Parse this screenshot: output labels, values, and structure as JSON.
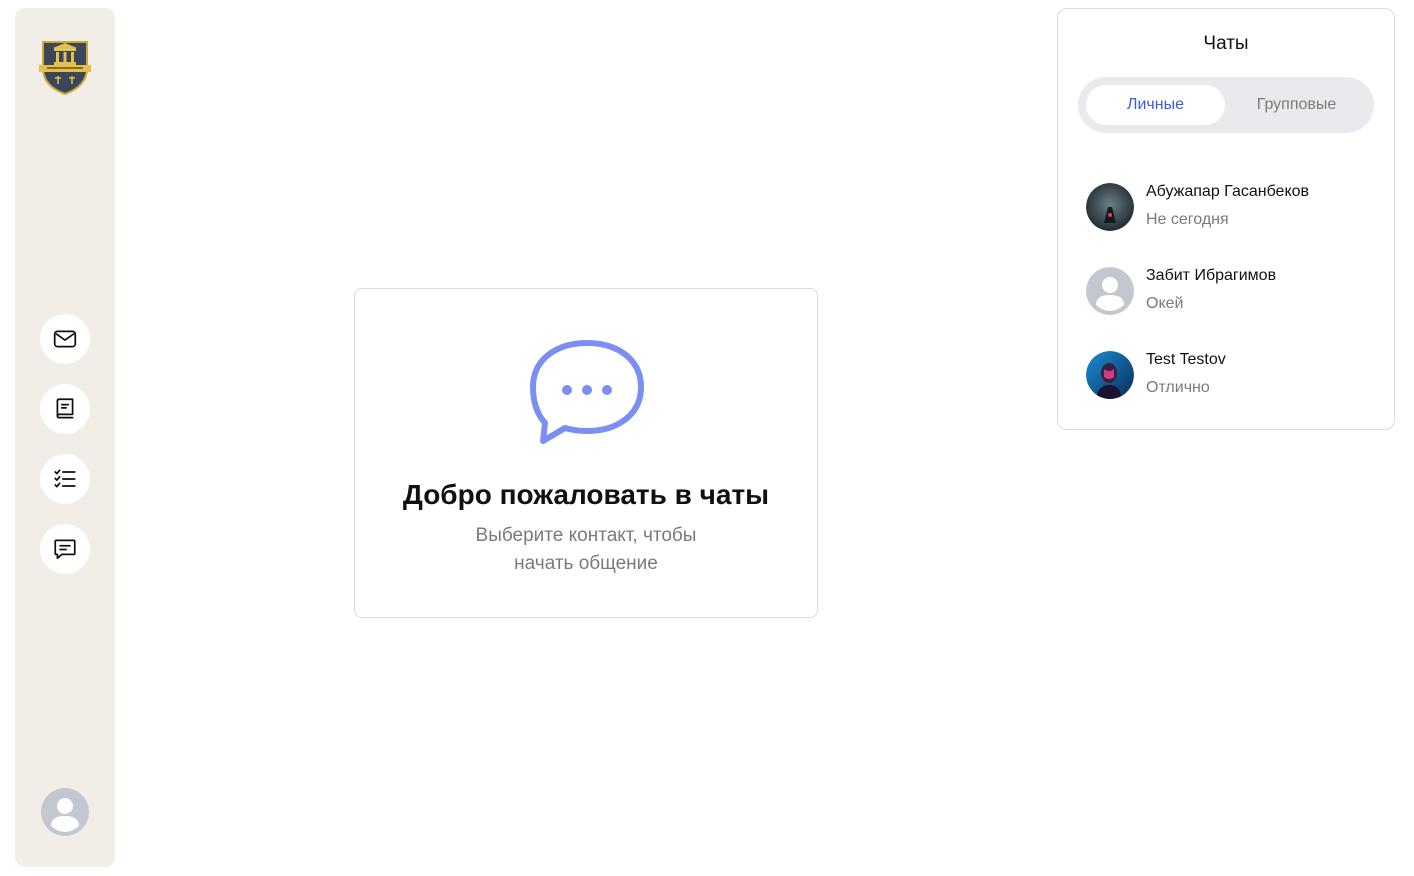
{
  "sidebar": {
    "logo_icon": "law-shield-logo",
    "nav": [
      {
        "icon": "mail-icon"
      },
      {
        "icon": "book-icon"
      },
      {
        "icon": "checklist-icon"
      },
      {
        "icon": "chat-icon"
      }
    ],
    "profile_icon": "user-avatar-icon"
  },
  "welcome": {
    "icon": "chat-bubble-dots-icon",
    "title": "Добро пожаловать в чаты",
    "subtitle": "Выберите контакт, чтобы начать общение"
  },
  "chats": {
    "title": "Чаты",
    "tabs": [
      {
        "label": "Личные",
        "active": true
      },
      {
        "label": "Групповые",
        "active": false
      }
    ],
    "contacts": [
      {
        "name": "Абужапар Гасанбеков",
        "last_message": "Не сегодня"
      },
      {
        "name": "Забит Ибрагимов",
        "last_message": "Окей"
      },
      {
        "name": "Test Testov",
        "last_message": "Отлично"
      }
    ]
  },
  "colors": {
    "sidebar_bg": "#f3ede8",
    "accent": "#3b5bdb",
    "chat_icon": "#7b8ff2",
    "tabs_bg": "#e9eaed",
    "muted_text": "#7a7a7a"
  }
}
